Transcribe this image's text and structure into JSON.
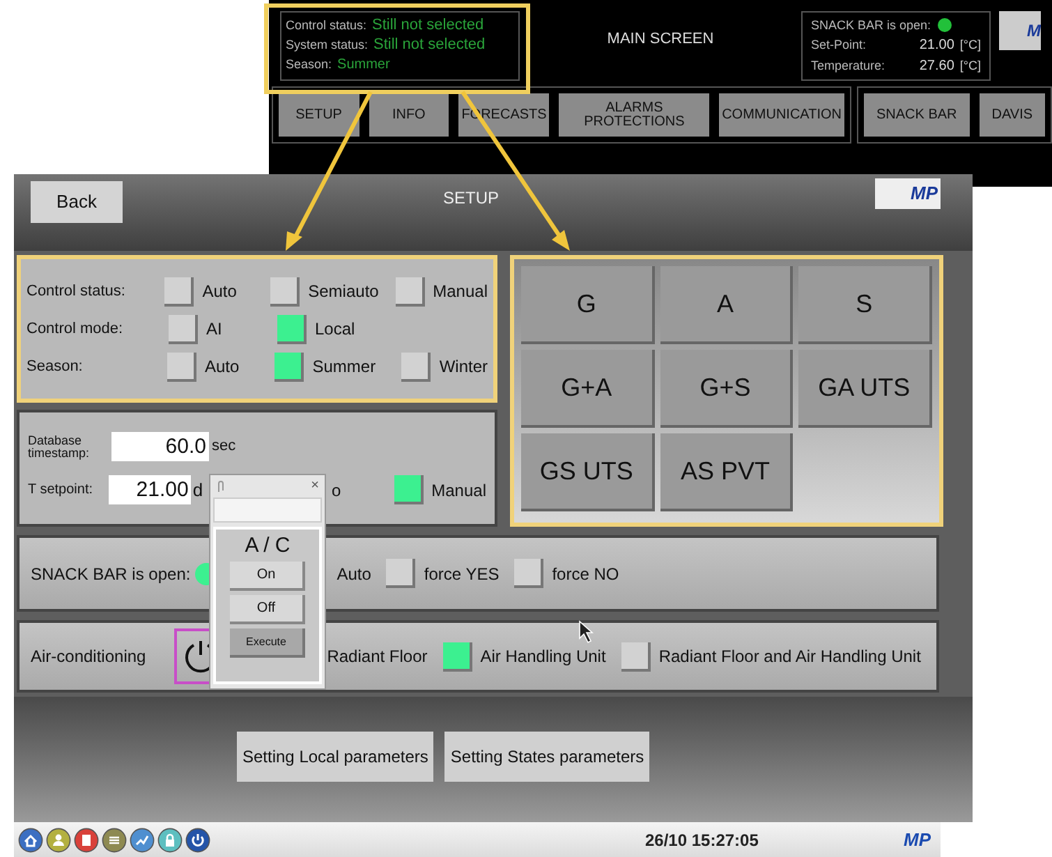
{
  "main_screen": {
    "status": [
      {
        "label": "Control status:",
        "value": "Still not selected"
      },
      {
        "label": "System status:",
        "value": "Still not selected"
      },
      {
        "label": "Season:",
        "value": "Summer"
      }
    ],
    "title": "MAIN SCREEN",
    "snack_bar": {
      "label": "SNACK BAR is open:",
      "open": true
    },
    "readings": [
      {
        "label": "Set-Point:",
        "value": "21.00",
        "unit": "[°C]"
      },
      {
        "label": "Temperature:",
        "value": "27.60",
        "unit": "[°C]"
      }
    ],
    "logo": "M",
    "tabs": [
      "SETUP",
      "INFO",
      "FORECASTS",
      "ALARMS PROTECTIONS",
      "COMMUNICATION"
    ],
    "side_tabs": [
      "SNACK BAR",
      "DAVIS"
    ]
  },
  "setup": {
    "back": "Back",
    "title": "SETUP",
    "logo": "MP",
    "mode_rows": [
      {
        "label": "Control status:",
        "options": [
          {
            "label": "Auto",
            "checked": false
          },
          {
            "label": "Semiauto",
            "checked": false
          },
          {
            "label": "Manual",
            "checked": false
          }
        ]
      },
      {
        "label": "Control mode:",
        "options": [
          {
            "label": "AI",
            "checked": false
          },
          {
            "label": "Local",
            "checked": true
          }
        ]
      },
      {
        "label": "Season:",
        "options": [
          {
            "label": "Auto",
            "checked": false
          },
          {
            "label": "Summer",
            "checked": true
          },
          {
            "label": "Winter",
            "checked": false
          }
        ]
      }
    ],
    "strategies": [
      "G",
      "A",
      "S",
      "G+A",
      "G+S",
      "GA UTS",
      "GS UTS",
      "AS PVT"
    ],
    "database_timestamp": {
      "label": "Database timestamp:",
      "value": "60.0",
      "unit": "sec"
    },
    "t_setpoint": {
      "label": "T setpoint:",
      "value": "21.00",
      "unit": "d",
      "options": [
        {
          "label": "o"
        },
        {
          "label": "Manual",
          "checked": true
        }
      ]
    },
    "snack_bar": {
      "label": "SNACK BAR is open:",
      "open": true,
      "options": [
        {
          "label": "Auto"
        },
        {
          "label": "force YES",
          "checked": false
        },
        {
          "label": "force NO",
          "checked": false
        }
      ]
    },
    "air_conditioning": {
      "label": "Air-conditioning",
      "options": [
        {
          "label": "Radiant Floor"
        },
        {
          "label": "Air Handling Unit",
          "checked": true
        },
        {
          "label": "Radiant Floor and Air Handling Unit",
          "checked": false
        }
      ]
    },
    "buttons": [
      "Setting Local parameters",
      "Setting States parameters"
    ]
  },
  "popup": {
    "close": "×",
    "heading": "A / C",
    "buttons": [
      "On",
      "Off"
    ],
    "action": "Execute"
  },
  "taskbar": {
    "clock": "26/10 15:27:05",
    "logo": "MP"
  }
}
